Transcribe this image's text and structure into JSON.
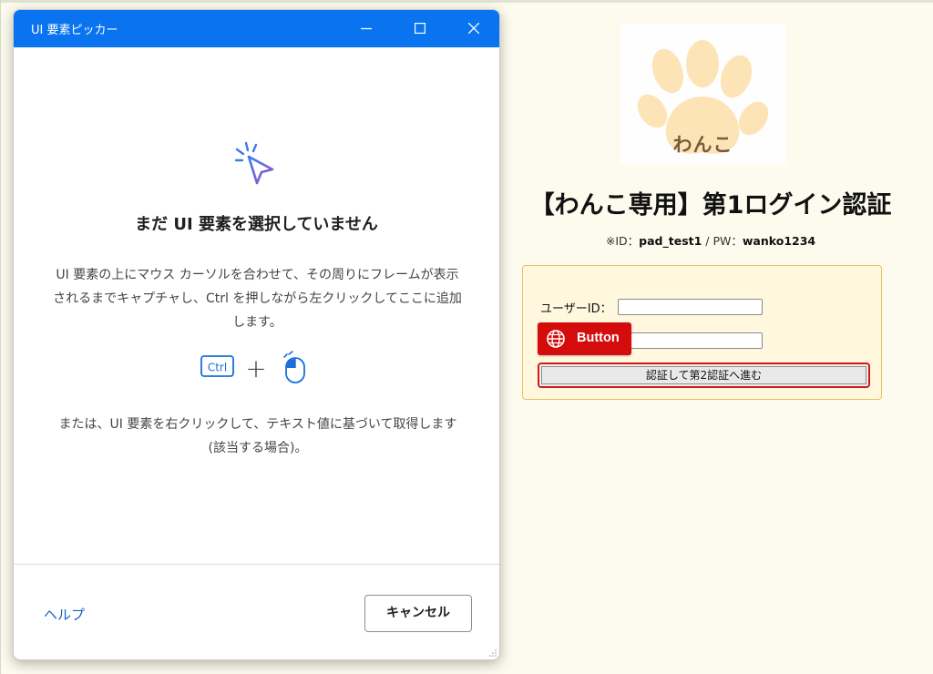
{
  "picker_window": {
    "title": "UI 要素ピッカー",
    "controls": {
      "minimize": "minimize-icon",
      "maximize": "maximize-icon",
      "close": "close-icon"
    },
    "empty_state": {
      "icon": "cursor-click-icon",
      "heading": "まだ UI 要素を選択していません",
      "instructions": "UI 要素の上にマウス カーソルを合わせて、その周りにフレームが表示されるまでキャプチャし、Ctrl を押しながら左クリックしてここに追加します。",
      "shortcut": {
        "key_label": "Ctrl",
        "plus": "+",
        "mouse_icon": "mouse-left-click-icon"
      },
      "alternative": "または、UI 要素を右クリックして、テキスト値に基づいて取得します (該当する場合)。"
    },
    "footer": {
      "help_label": "ヘルプ",
      "cancel_label": "キャンセル"
    }
  },
  "web_page": {
    "logo": {
      "icon": "paw-icon",
      "text": "わんこ"
    },
    "title": "【わんこ専用】第1ログイン認証",
    "credentials": {
      "id_prefix": "※ID：",
      "id_value": "pad_test1",
      "pw_prefix": " / PW：",
      "pw_value": "wanko1234"
    },
    "form": {
      "userid_label": "ユーザーID：",
      "userid_value": "",
      "password_value": "",
      "submit_label": "認証して第2認証へ進む"
    },
    "element_highlight_tag": {
      "icon": "globe-icon",
      "label": "Button"
    }
  },
  "colors": {
    "titlebar": "#0a74f0",
    "link": "#1463c6",
    "highlight_red": "#d40c0c",
    "form_border": "#e7c35e",
    "page_background": "#fcfbed"
  }
}
